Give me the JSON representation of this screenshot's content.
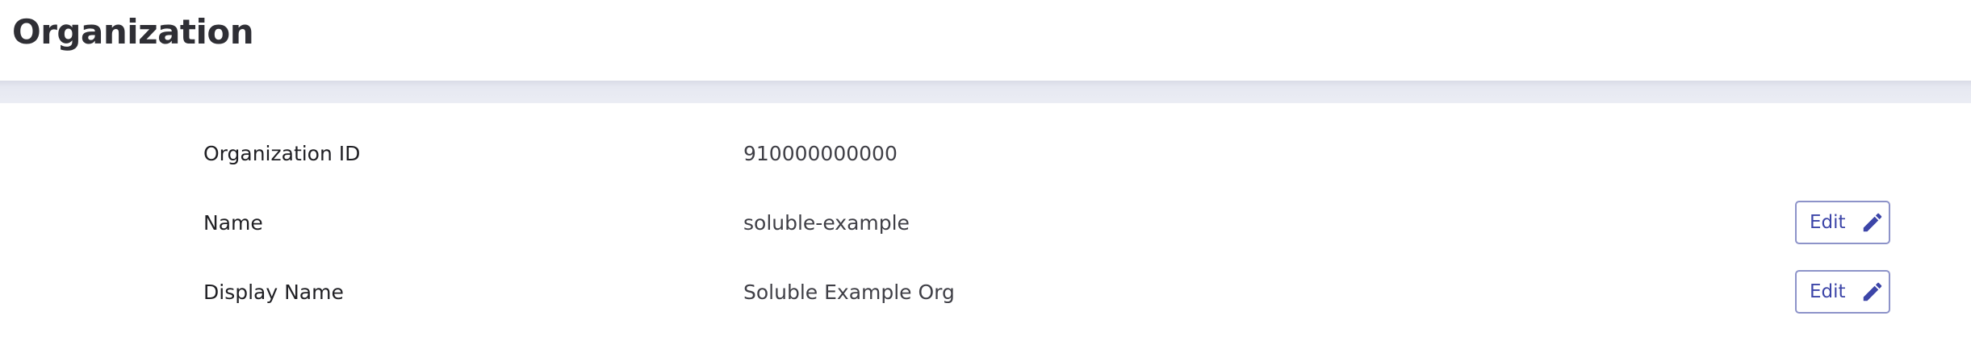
{
  "header": {
    "title": "Organization"
  },
  "rows": [
    {
      "label": "Organization ID",
      "value": "910000000000"
    },
    {
      "label": "Name",
      "value": "soluble-example",
      "action_label": "Edit",
      "action_icon": "pencil-icon"
    },
    {
      "label": "Display Name",
      "value": "Soluble Example Org",
      "action_label": "Edit",
      "action_icon": "pencil-icon"
    }
  ],
  "colors": {
    "accent": "#3c45a8",
    "button_border": "#8d93c9",
    "divider_band": "#e6e8f1",
    "title_text": "#2f2f35"
  }
}
